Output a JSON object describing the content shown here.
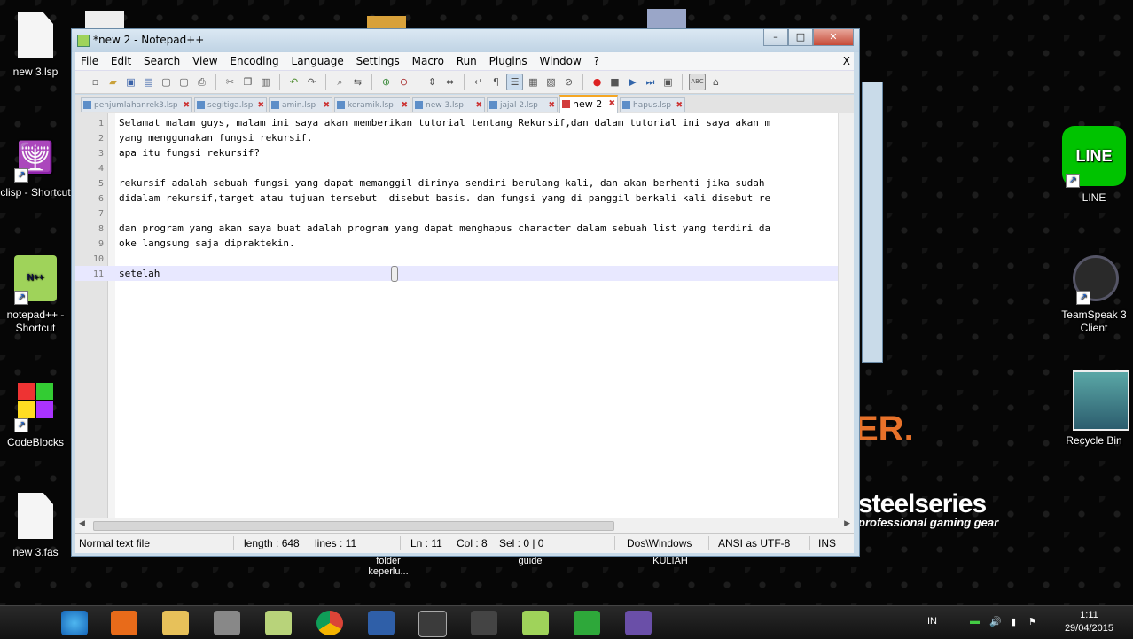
{
  "window": {
    "title": "*new  2 - Notepad++",
    "controls": {
      "minimize": "–",
      "maximize": "□",
      "close": "✕"
    }
  },
  "menu": {
    "items": [
      "File",
      "Edit",
      "Search",
      "View",
      "Encoding",
      "Language",
      "Settings",
      "Macro",
      "Run",
      "Plugins",
      "Window",
      "?"
    ],
    "close": "X"
  },
  "tabs": [
    {
      "label": "penjumlahanrek3.lsp"
    },
    {
      "label": "segitiga.lsp"
    },
    {
      "label": "amin.lsp"
    },
    {
      "label": "keramik.lsp"
    },
    {
      "label": "new  3.lsp"
    },
    {
      "label": "jajal 2.lsp"
    },
    {
      "label": "new  2",
      "active": true
    },
    {
      "label": "hapus.lsp"
    }
  ],
  "editor": {
    "lines": [
      {
        "n": "1",
        "text": "Selamat malam guys, malam ini saya akan memberikan tutorial tentang Rekursif,dan dalam tutorial ini saya akan m"
      },
      {
        "n": "2",
        "text": "yang menggunakan fungsi rekursif."
      },
      {
        "n": "3",
        "text": "apa itu fungsi rekursif?"
      },
      {
        "n": "4",
        "text": ""
      },
      {
        "n": "5",
        "text": "rekursif adalah sebuah fungsi yang dapat memanggil dirinya sendiri berulang kali, dan akan berhenti jika sudah"
      },
      {
        "n": "6",
        "text": "didalam rekursif,target atau tujuan tersebut  disebut basis. dan fungsi yang di panggil berkali kali disebut re"
      },
      {
        "n": "7",
        "text": ""
      },
      {
        "n": "8",
        "text": "dan program yang akan saya buat adalah program yang dapat menghapus character dalam sebuah list yang terdiri da"
      },
      {
        "n": "9",
        "text": "oke langsung saja dipraktekin."
      },
      {
        "n": "10",
        "text": ""
      },
      {
        "n": "11",
        "text": "setelah",
        "current": true
      }
    ]
  },
  "status": {
    "file_type": "Normal text file",
    "length": "length : 648",
    "lines": "lines : 11",
    "ln": "Ln : 11",
    "col": "Col : 8",
    "sel": "Sel : 0 | 0",
    "eol": "Dos\\Windows",
    "encoding": "ANSI as UTF-8",
    "mode": "INS"
  },
  "desktop": {
    "left_icons": [
      {
        "label": "new  3.lsp",
        "icon": "document-icon"
      },
      {
        "label": "clisp - Shortcut",
        "icon": "menorah-icon"
      },
      {
        "label": "notepad++ - Shortcut",
        "icon": "notepad-plus-plus-icon"
      },
      {
        "label": "CodeBlocks",
        "icon": "codeblocks-icon"
      },
      {
        "label": "new  3.fas",
        "icon": "document-icon"
      }
    ],
    "right_icons": [
      {
        "label": "LINE",
        "icon": "line-app-icon"
      },
      {
        "label": "TeamSpeak 3 Client",
        "icon": "teamspeak-icon"
      },
      {
        "label": "Recycle Bin",
        "icon": "recycle-bin-icon"
      }
    ],
    "wallpaper_text": {
      "brand": "steelseries",
      "tagline": "professional gaming gear",
      "fragment": "ER."
    },
    "behind_labels": [
      {
        "label": "folder keperlu..."
      },
      {
        "label": "guide"
      },
      {
        "label": "KULIAH"
      }
    ],
    "line_logo_text": "LINE"
  },
  "taskbar": {
    "apps": [
      "internet-explorer-icon",
      "media-player-icon",
      "file-explorer-icon",
      "user-tool-icon",
      "notes-icon",
      "chrome-icon",
      "lisp-ide-icon",
      "terminal-icon",
      "crossfire-icon",
      "notepad-plus-plus-icon",
      "camtasia-icon",
      "clisp-icon"
    ],
    "language": "IN",
    "time": "1:11",
    "date": "29/04/2015"
  }
}
